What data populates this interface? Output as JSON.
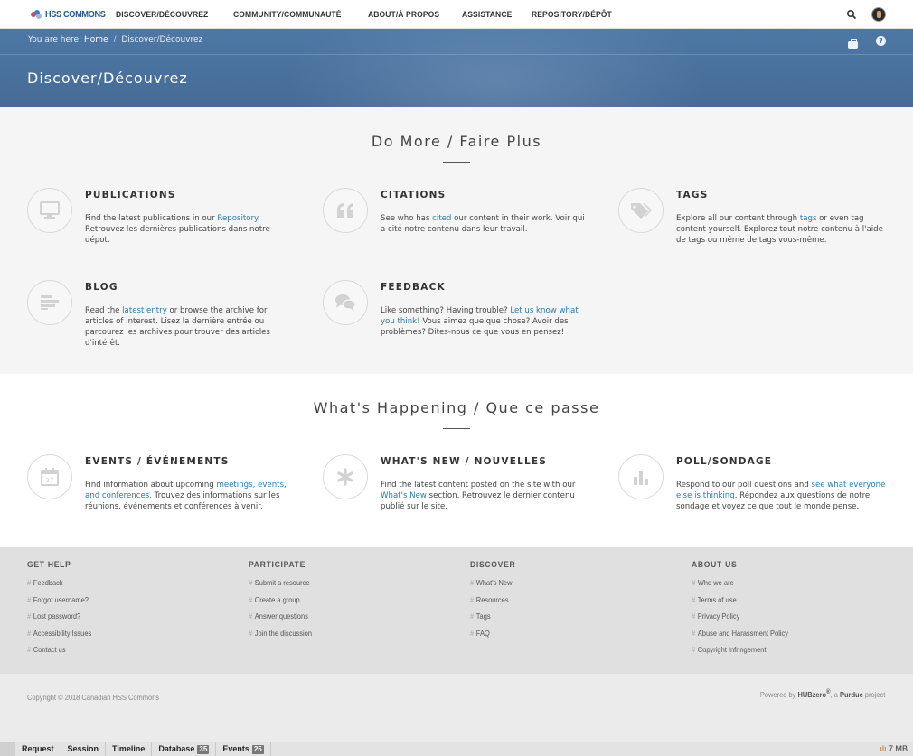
{
  "nav": {
    "logo_text": "HSS COMMONS",
    "links": [
      "DISCOVER/DÉCOUVREZ",
      "COMMUNITY/COMMUNAUTÉ",
      "ABOUT/À PROPOS",
      "ASSISTANCE",
      "REPOSITORY/DÉPÔT"
    ]
  },
  "breadcrumb": {
    "prefix": "You are here:",
    "home": "Home",
    "separator": "/",
    "current": "Discover/Découvrez"
  },
  "page_title": "Discover/Découvrez",
  "section1": {
    "heading": "Do More / Faire Plus",
    "features": [
      {
        "title": "PUBLICATIONS",
        "icon": "monitor-icon",
        "t1": "Find the latest publications in our ",
        "link": "Repository",
        "t2": ". Retrouvez les dernières publications dans notre dépot."
      },
      {
        "title": "CITATIONS",
        "icon": "quote-icon",
        "t1": "See who has ",
        "link": "cited",
        "t2": " our content in their work. Voir qui a cité notre contenu dans leur travail."
      },
      {
        "title": "TAGS",
        "icon": "tag-icon",
        "t1": "Explore all our content through ",
        "link": "tags",
        "t2": " or even tag content yourself. Explorez tout notre contenu à l'aide de tags ou même de tags vous-même."
      },
      {
        "title": "BLOG",
        "icon": "blog-lines-icon",
        "t1": "Read the ",
        "link": "latest entry",
        "t2": " or browse the archive for articles of interest. Lisez la dernière entrée ou parcourez les archives pour trouver des articles d'intérêt."
      },
      {
        "title": "FEEDBACK",
        "icon": "chat-bubbles-icon",
        "t1": "Like something? Having trouble? ",
        "link": "Let us know what you think!",
        "t2": " Vous aimez quelque chose? Avoir des problèmes? Dites-nous ce que vous en pensez!"
      }
    ]
  },
  "section2": {
    "heading": "What's Happening / Que ce passe",
    "features": [
      {
        "title": "EVENTS / ÉVÉNEMENTS",
        "icon": "calendar-icon",
        "t1": "Find information about upcoming ",
        "link": "meetings, events, and conferences",
        "t2": ". Trouvez des informations sur les réunions, événements et conférences à venir."
      },
      {
        "title": "WHAT'S NEW / NOUVELLES",
        "icon": "asterisk-icon",
        "t1": "Find the latest content posted on the site with our ",
        "link": "What's New",
        "t2": " section. Retrouvez le dernier contenu publié sur le site."
      },
      {
        "title": "POLL/SONDAGE",
        "icon": "bar-chart-icon",
        "t1": "Respond to our poll questions and ",
        "link": "see what everyone else is thinking",
        "t2": ". Répondez aux questions de notre sondage et voyez ce que tout le monde pense."
      }
    ]
  },
  "footer": {
    "columns": [
      {
        "title": "GET HELP",
        "links": [
          "Feedback",
          "Forgot username?",
          "Lost password?",
          "Accessibility Issues",
          "Contact us"
        ]
      },
      {
        "title": "PARTICIPATE",
        "links": [
          "Submit a resource",
          "Create a group",
          "Answer questions",
          "Join the discussion"
        ]
      },
      {
        "title": "DISCOVER",
        "links": [
          "What's New",
          "Resources",
          "Tags",
          "FAQ"
        ]
      },
      {
        "title": "ABOUT US",
        "links": [
          "Who we are",
          "Terms of use",
          "Privacy Policy",
          "Abuse and Harassment Policy",
          "Copyright Infringement"
        ]
      }
    ],
    "hash": "#",
    "copyright": "Copyright © 2018 Canadian HSS Commons",
    "powered_prefix": "Powered by ",
    "powered_brand": "HUBzero",
    "powered_reg": "®",
    "powered_mid": ", a ",
    "powered_org": "Purdue",
    "powered_suffix": " project"
  },
  "debug": {
    "tabs": [
      {
        "label": "Request",
        "count": null
      },
      {
        "label": "Session",
        "count": null
      },
      {
        "label": "Timeline",
        "count": null
      },
      {
        "label": "Database",
        "count": "35"
      },
      {
        "label": "Events",
        "count": "25"
      }
    ],
    "memory": "7 MB"
  },
  "colors": {
    "link": "#2a7ab0",
    "banner": "#4b739f",
    "footer": "#e0e0e0"
  }
}
